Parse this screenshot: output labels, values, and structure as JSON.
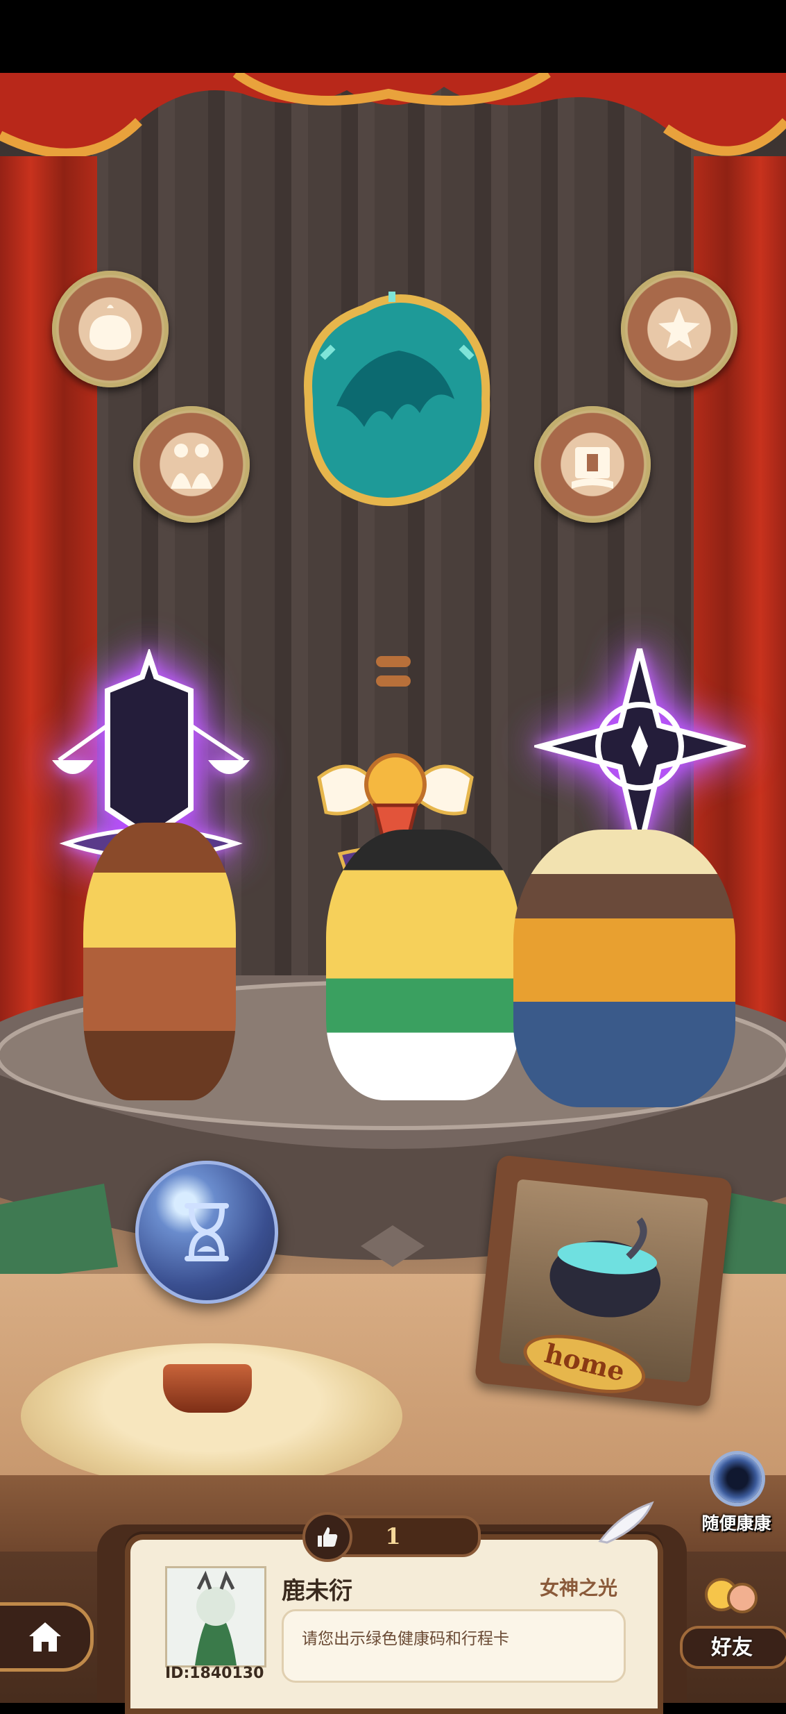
{
  "likes": {
    "count": "1"
  },
  "profile": {
    "nickname": "鹿未衍",
    "id_label": "ID:1840130",
    "title": "女神之光",
    "message": "请您出示绿色健康码和行程卡"
  },
  "frame": {
    "label": "home"
  },
  "buttons": {
    "random_visit": "随便康康",
    "friends": "好友"
  },
  "colors": {
    "curtain": "#c8321d",
    "stage_floor": "#d8ad84",
    "gold_trim": "#e6b64c",
    "purple_glow": "#b040ff",
    "teal_badge": "#1e9a98"
  }
}
